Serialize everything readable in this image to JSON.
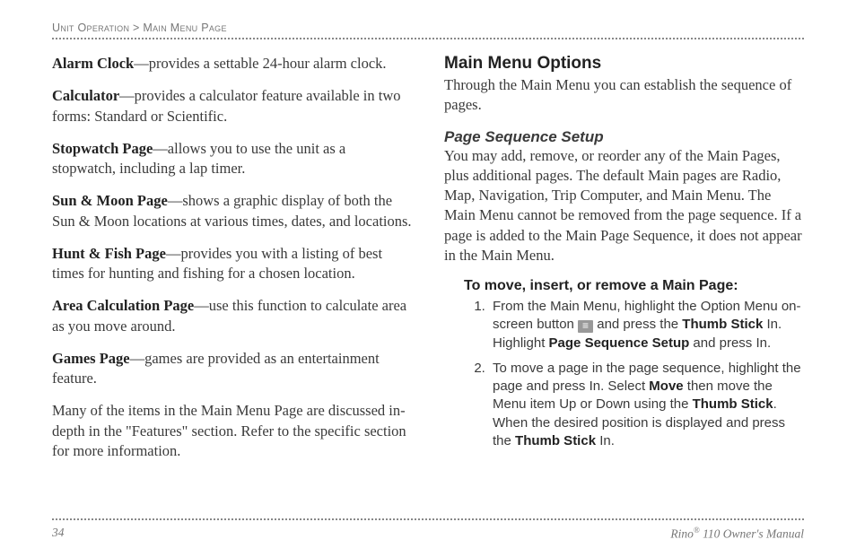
{
  "header": {
    "section": "Unit Operation",
    "sep": " > ",
    "page": "Main Menu Page"
  },
  "left": {
    "items": [
      {
        "term": "Alarm Clock",
        "desc": "—provides a settable 24-hour alarm clock."
      },
      {
        "term": "Calculator",
        "desc": "—provides a calculator feature available in two forms: Standard or Scientific."
      },
      {
        "term": "Stopwatch Page",
        "desc": "—allows you to use the unit as a stopwatch, including a lap timer."
      },
      {
        "term": "Sun & Moon Page",
        "desc": "—shows a graphic display of both the Sun & Moon locations at various times, dates, and locations."
      },
      {
        "term": "Hunt & Fish Page",
        "desc": "—provides you with a listing of best times for hunting and fishing for a chosen location."
      },
      {
        "term": "Area Calculation Page",
        "desc": "—use this function to calculate area as you move around."
      },
      {
        "term": "Games Page",
        "desc": "—games are provided as an entertainment feature."
      }
    ],
    "tail": "Many of the items in the Main Menu Page are discussed in-depth in the \"Features\" section. Refer to the specific section for more information."
  },
  "right": {
    "h2": "Main Menu Options",
    "intro": "Through the Main Menu you can establish the sequence of pages.",
    "h3": "Page Sequence Setup",
    "para": "You may add, remove, or reorder any of the Main Pages, plus additional pages. The default Main pages are Radio, Map, Navigation, Trip Computer, and Main Menu. The Main Menu cannot be removed from the page sequence. If a page is added to the Main Page Sequence, it does not appear in the Main Menu.",
    "inst_head": "To move, insert, or remove a Main Page:",
    "step1": {
      "a": "From the Main Menu, highlight the Option Menu on-screen button ",
      "b": " and press the ",
      "c": "Thumb Stick",
      "d": " In. Highlight ",
      "e": "Page Sequence Setup",
      "f": " and press In."
    },
    "step2": {
      "a": "To move a page in the page sequence, highlight the page and press In. Select ",
      "b": "Move",
      "c": " then move the Menu item Up or Down using the ",
      "d": "Thumb Stick",
      "e": ". When the desired position is displayed and press the ",
      "f": "Thumb Stick",
      "g": " In."
    }
  },
  "footer": {
    "pagenum": "34",
    "product_a": "Rino",
    "product_b": " 110 Owner's Manual"
  }
}
